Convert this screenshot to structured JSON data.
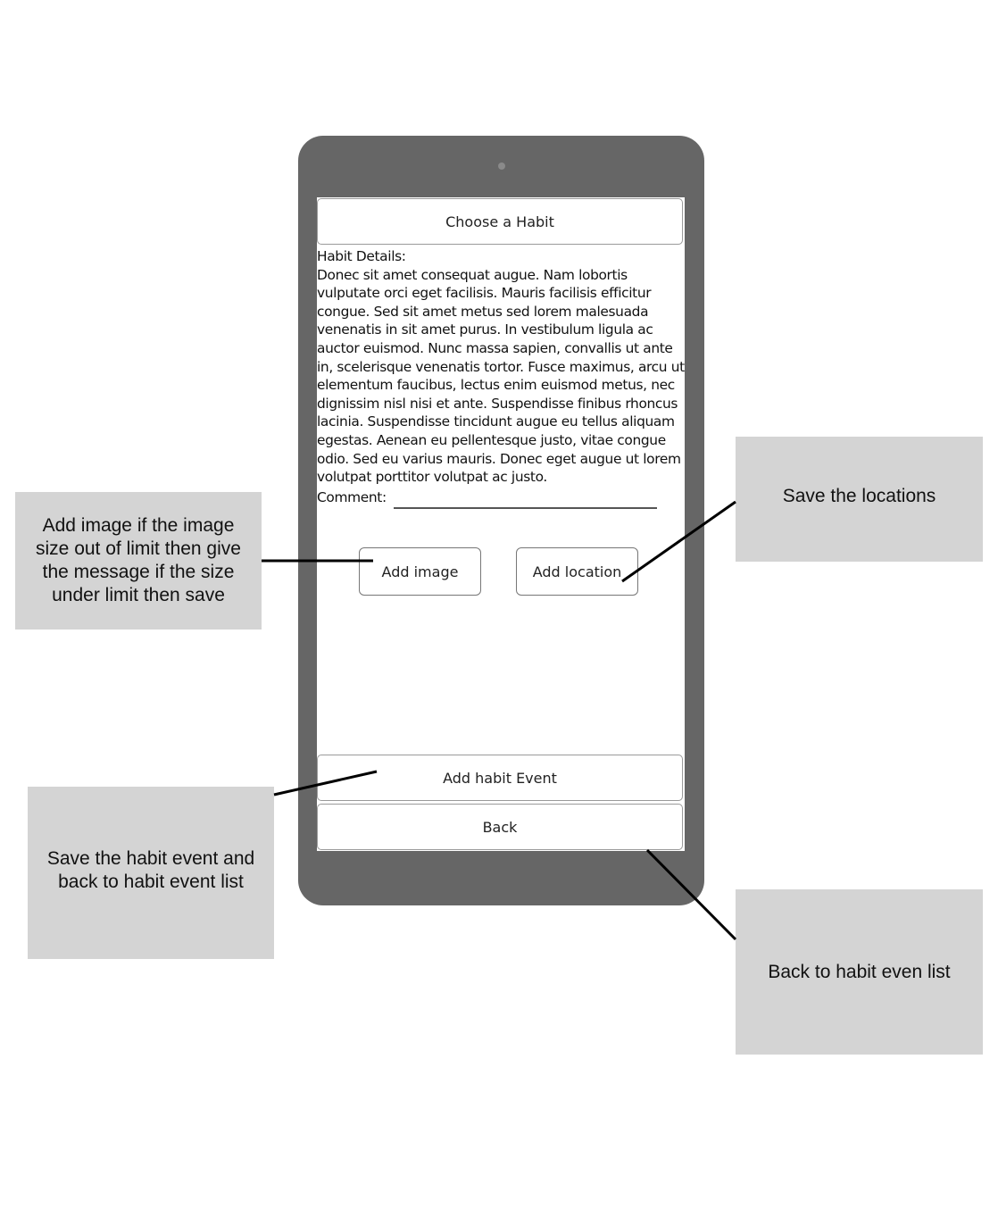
{
  "screen": {
    "choose_habit_label": "Choose a Habit",
    "habit_details_label": "Habit Details:",
    "habit_details_text": "Donec sit amet consequat augue. Nam lobortis vulputate orci eget facilisis. Mauris facilisis efficitur congue. Sed sit amet metus sed lorem malesuada venenatis in sit amet purus. In vestibulum ligula ac auctor euismod. Nunc massa sapien, convallis ut ante in, scelerisque venenatis tortor. Fusce maximus, arcu ut elementum faucibus, lectus enim euismod metus, nec dignissim nisl nisi et ante. Suspendisse finibus rhoncus lacinia. Suspendisse tincidunt augue eu tellus aliquam egestas. Aenean eu pellentesque justo, vitae congue odio. Sed eu varius mauris. Donec eget augue ut lorem volutpat porttitor volutpat ac justo.",
    "comment_label": "Comment:",
    "comment_value": "",
    "add_image_label": "Add image",
    "add_location_label": "Add location",
    "add_habit_event_label": "Add habit Event",
    "back_label": "Back"
  },
  "annotations": {
    "add_image": "Add image if the image size out of limit then give the message if the size under limit then save",
    "save_locations": "Save the locations",
    "save_habit_event": "Save the habit event and back to habit event list",
    "back": "Back to habit even list"
  },
  "colors": {
    "device_frame": "#666666",
    "annotation_bg": "#d4d4d4",
    "screen_bg": "#ffffff"
  }
}
